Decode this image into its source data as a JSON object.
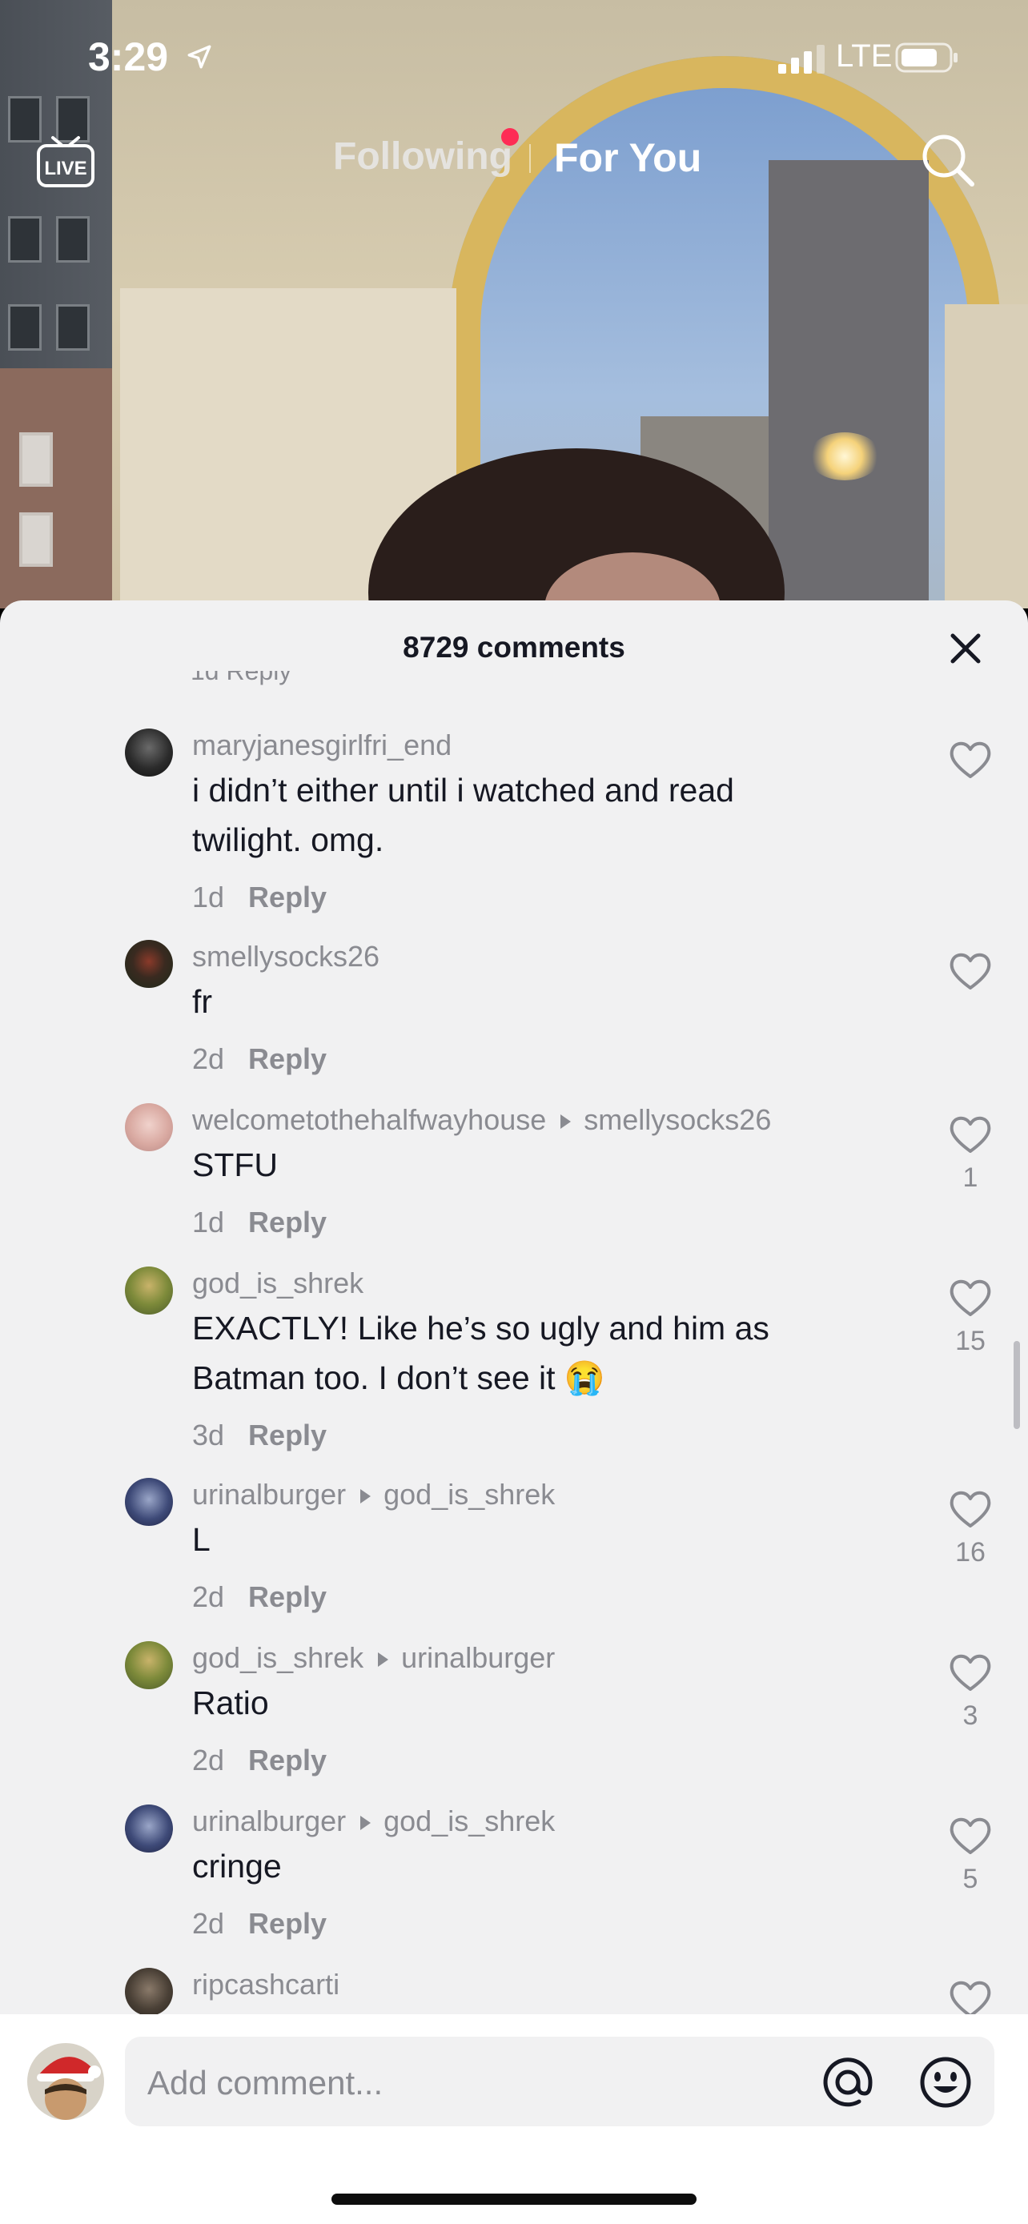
{
  "status_bar": {
    "time": "3:29",
    "network": "LTE"
  },
  "top_nav": {
    "live_label": "LIVE",
    "following": "Following",
    "for_you": "For You"
  },
  "comments_panel": {
    "title": "8729 comments",
    "clipped_meta": "1d  Reply",
    "comments": [
      {
        "username": "maryjanesgirlfri_end",
        "reply_to": "",
        "text": "i didn’t either until i watched and read twilight. omg.",
        "age": "1d",
        "reply": "Reply",
        "likes": ""
      },
      {
        "username": "smellysocks26",
        "reply_to": "",
        "text": "fr",
        "age": "2d",
        "reply": "Reply",
        "likes": ""
      },
      {
        "username": "welcometothehalfwayhouse",
        "reply_to": "smellysocks26",
        "text": "STFU",
        "age": "1d",
        "reply": "Reply",
        "likes": "1"
      },
      {
        "username": "god_is_shrek",
        "reply_to": "",
        "text": "EXACTLY! Like he’s so ugly and him as Batman too. I don’t see it 😭",
        "age": "3d",
        "reply": "Reply",
        "likes": "15"
      },
      {
        "username": "urinalburger",
        "reply_to": "god_is_shrek",
        "text": "L",
        "age": "2d",
        "reply": "Reply",
        "likes": "16"
      },
      {
        "username": "god_is_shrek",
        "reply_to": "urinalburger",
        "text": "Ratio",
        "age": "2d",
        "reply": "Reply",
        "likes": "3"
      },
      {
        "username": "urinalburger",
        "reply_to": "god_is_shrek",
        "text": "cringe",
        "age": "2d",
        "reply": "Reply",
        "likes": "5"
      },
      {
        "username": "ripcashcarti",
        "reply_to": "",
        "text": "",
        "age": "",
        "reply": "",
        "likes": ""
      }
    ]
  },
  "input_bar": {
    "placeholder": "Add comment..."
  },
  "colors": {
    "accent_dot": "#fe2c55",
    "panel_bg": "#f1f1f2",
    "muted_text": "#8a8b91",
    "text": "#161823"
  },
  "icons": [
    "location-arrow-icon",
    "signal-icon",
    "battery-icon",
    "live-tv-icon",
    "search-icon",
    "close-icon",
    "heart-icon",
    "at-icon",
    "emoji-icon"
  ]
}
